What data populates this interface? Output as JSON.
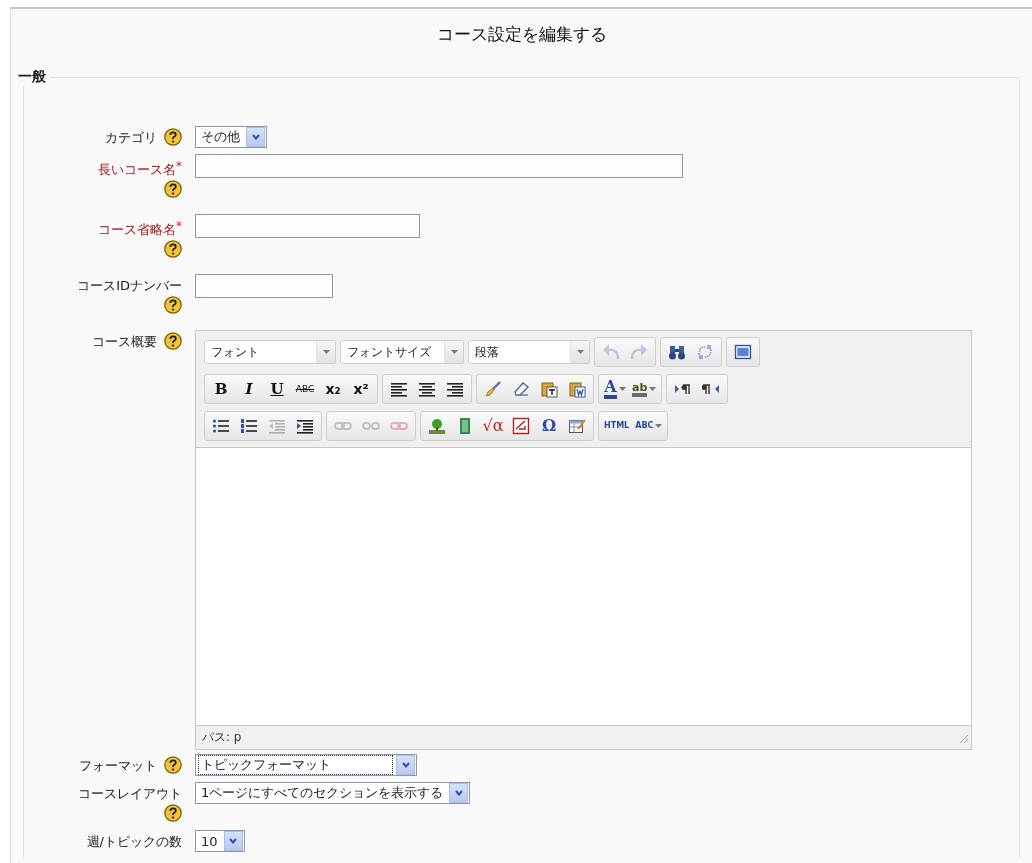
{
  "page_title": "コース設定を編集する",
  "section": {
    "legend": "一般",
    "fields": [
      {
        "kind": "select",
        "label": "カテゴリ",
        "required": false,
        "help": true,
        "value": "その他",
        "focused": false
      },
      {
        "kind": "text",
        "label": "長いコース名",
        "required": true,
        "mark": "*",
        "help": true
      },
      {
        "kind": "text",
        "label": "コース省略名",
        "required": true,
        "mark": "*",
        "help": true
      },
      {
        "kind": "text",
        "label": "コースIDナンバー",
        "required": false,
        "help": true
      },
      {
        "kind": "editor",
        "label": "コース概要",
        "required": false,
        "help": true,
        "path": "パス: p",
        "toolbar": [
          [
            [
              {
                "kind": "select",
                "text": "フォント"
              }
            ],
            [
              {
                "kind": "select",
                "text": "フォントサイズ"
              }
            ],
            [
              {
                "kind": "select",
                "text": "段落"
              }
            ],
            [
              {
                "kind": "undo",
                "disabled": true
              },
              {
                "kind": "redo",
                "disabled": true
              }
            ],
            [
              {
                "kind": "find",
                "disabled": false
              },
              {
                "kind": "replace",
                "disabled": false
              }
            ],
            [
              {
                "kind": "fullscreen",
                "disabled": false
              }
            ]
          ],
          [
            [
              {
                "kind": "bold",
                "text": "B",
                "disabled": false
              },
              {
                "kind": "italic",
                "text": "I",
                "disabled": false
              },
              {
                "kind": "underline",
                "text": "U",
                "disabled": false
              },
              {
                "kind": "strike",
                "text": "ABC",
                "disabled": false
              },
              {
                "kind": "sub",
                "text": "x₂",
                "disabled": false
              },
              {
                "kind": "sup",
                "text": "x²",
                "disabled": false
              }
            ],
            [
              {
                "kind": "alignleft",
                "disabled": false
              },
              {
                "kind": "aligncenter",
                "disabled": false
              },
              {
                "kind": "alignright",
                "disabled": false
              }
            ],
            [
              {
                "kind": "cleanup",
                "disabled": false
              },
              {
                "kind": "eraser",
                "disabled": false
              },
              {
                "kind": "pastetext",
                "disabled": false
              },
              {
                "kind": "pasteword",
                "disabled": false
              }
            ],
            [
              {
                "kind": "forecolor",
                "text": "A",
                "split": true,
                "disabled": false
              },
              {
                "kind": "hilite",
                "text": "ab",
                "split": true,
                "disabled": false
              }
            ],
            [
              {
                "kind": "ltr",
                "disabled": false
              },
              {
                "kind": "rtl",
                "disabled": false
              }
            ]
          ],
          [
            [
              {
                "kind": "bullets",
                "disabled": false
              },
              {
                "kind": "numbers",
                "disabled": false
              },
              {
                "kind": "outdent",
                "disabled": true
              },
              {
                "kind": "indent",
                "disabled": false
              }
            ],
            [
              {
                "kind": "link",
                "disabled": true
              },
              {
                "kind": "unlink",
                "disabled": true
              },
              {
                "kind": "anchor",
                "disabled": true
              }
            ],
            [
              {
                "kind": "image",
                "disabled": false
              },
              {
                "kind": "media",
                "disabled": false
              },
              {
                "kind": "equation",
                "text": "√α",
                "disabled": false
              },
              {
                "kind": "nolink",
                "disabled": false
              },
              {
                "kind": "charmap",
                "text": "Ω",
                "disabled": false
              },
              {
                "kind": "table",
                "disabled": false
              }
            ],
            [
              {
                "kind": "html",
                "text": "HTML",
                "disabled": false
              },
              {
                "kind": "spell",
                "text": "ABC",
                "split": true,
                "disabled": false
              }
            ]
          ]
        ]
      },
      {
        "kind": "select",
        "label": "フォーマット",
        "required": false,
        "help": true,
        "value": "トピックフォーマット",
        "focused": true
      },
      {
        "kind": "select",
        "label": "コースレイアウト",
        "required": false,
        "help": true,
        "value": "1ページにすべてのセクションを表示する",
        "focused": false
      },
      {
        "kind": "select",
        "label": "週/トピックの数",
        "required": false,
        "help": false,
        "value": "10",
        "focused": false
      }
    ]
  }
}
